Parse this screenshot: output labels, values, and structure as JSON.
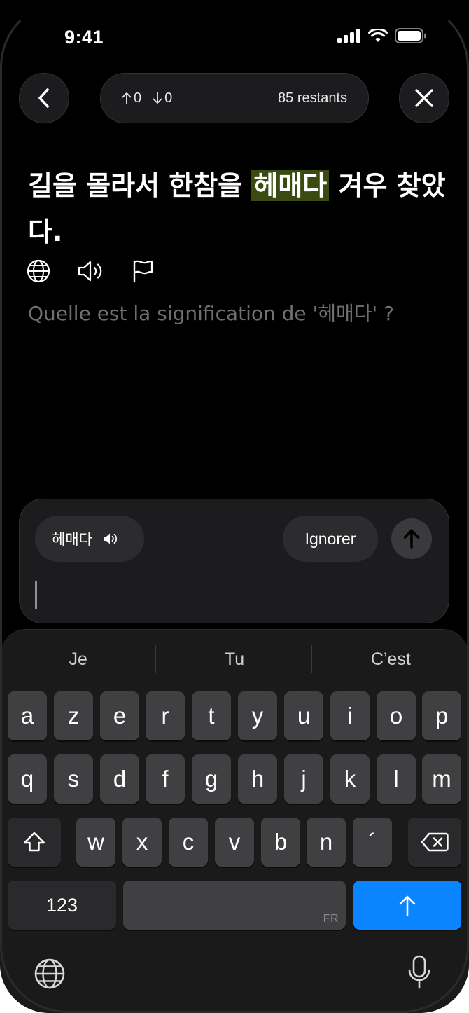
{
  "status_bar": {
    "time": "9:41"
  },
  "top_bar": {
    "up_count": "0",
    "down_count": "0",
    "remaining": "85 restants"
  },
  "sentence": {
    "before": "길을 몰라서 한참을 ",
    "highlight": "헤매다",
    "after": " 겨우 찾았다."
  },
  "question": "Quelle est la signification de '헤매다' ?",
  "answer": {
    "word_chip": "헤매다",
    "ignore_label": "Ignorer",
    "input_value": ""
  },
  "keyboard": {
    "suggestions": [
      "Je",
      "Tu",
      "C’est"
    ],
    "row1": [
      "a",
      "z",
      "e",
      "r",
      "t",
      "y",
      "u",
      "i",
      "o",
      "p"
    ],
    "row2": [
      "q",
      "s",
      "d",
      "f",
      "g",
      "h",
      "j",
      "k",
      "l",
      "m"
    ],
    "row3": [
      "w",
      "x",
      "c",
      "v",
      "b",
      "n",
      "´"
    ],
    "numbers_label": "123",
    "space_language": "FR"
  },
  "colors": {
    "highlight": "#3a4a10",
    "accent": "#0a84ff",
    "background": "#000000"
  }
}
